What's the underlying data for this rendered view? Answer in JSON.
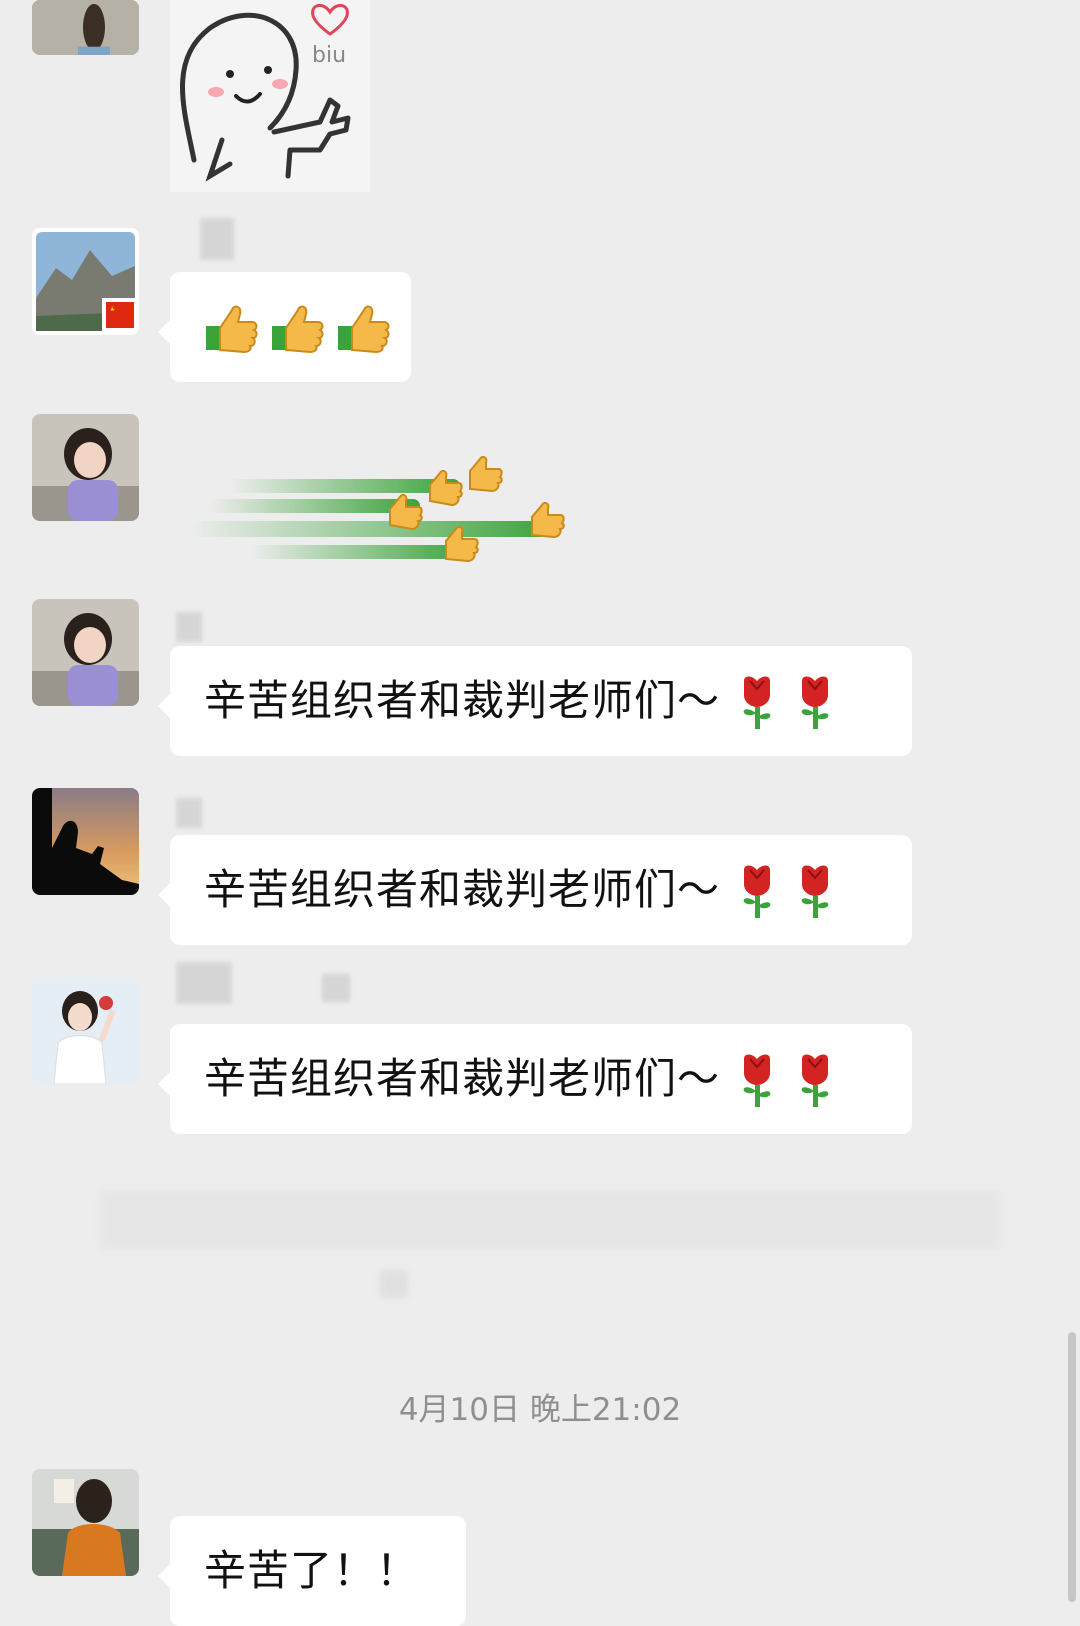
{
  "sticker_top": {
    "caption": "biu"
  },
  "messages": [
    {
      "id": "m2",
      "emoji": "👍👍👍"
    },
    {
      "id": "m4",
      "text": "辛苦组织者和裁判老师们～"
    },
    {
      "id": "m5",
      "text": "辛苦组织者和裁判老师们～"
    },
    {
      "id": "m6",
      "text": "辛苦组织者和裁判老师们～"
    },
    {
      "id": "m7",
      "text": "辛苦了！！"
    }
  ],
  "timestamp": "4月10日 晚上21:02",
  "colors": {
    "background": "#ededed",
    "bubble": "#ffffff",
    "timestamp": "#8f8f8f",
    "rose_red": "#d32323",
    "stem_green": "#3aa33a"
  },
  "icons": [
    "rose-icon",
    "thumbs-up-icon",
    "heart-icon"
  ]
}
